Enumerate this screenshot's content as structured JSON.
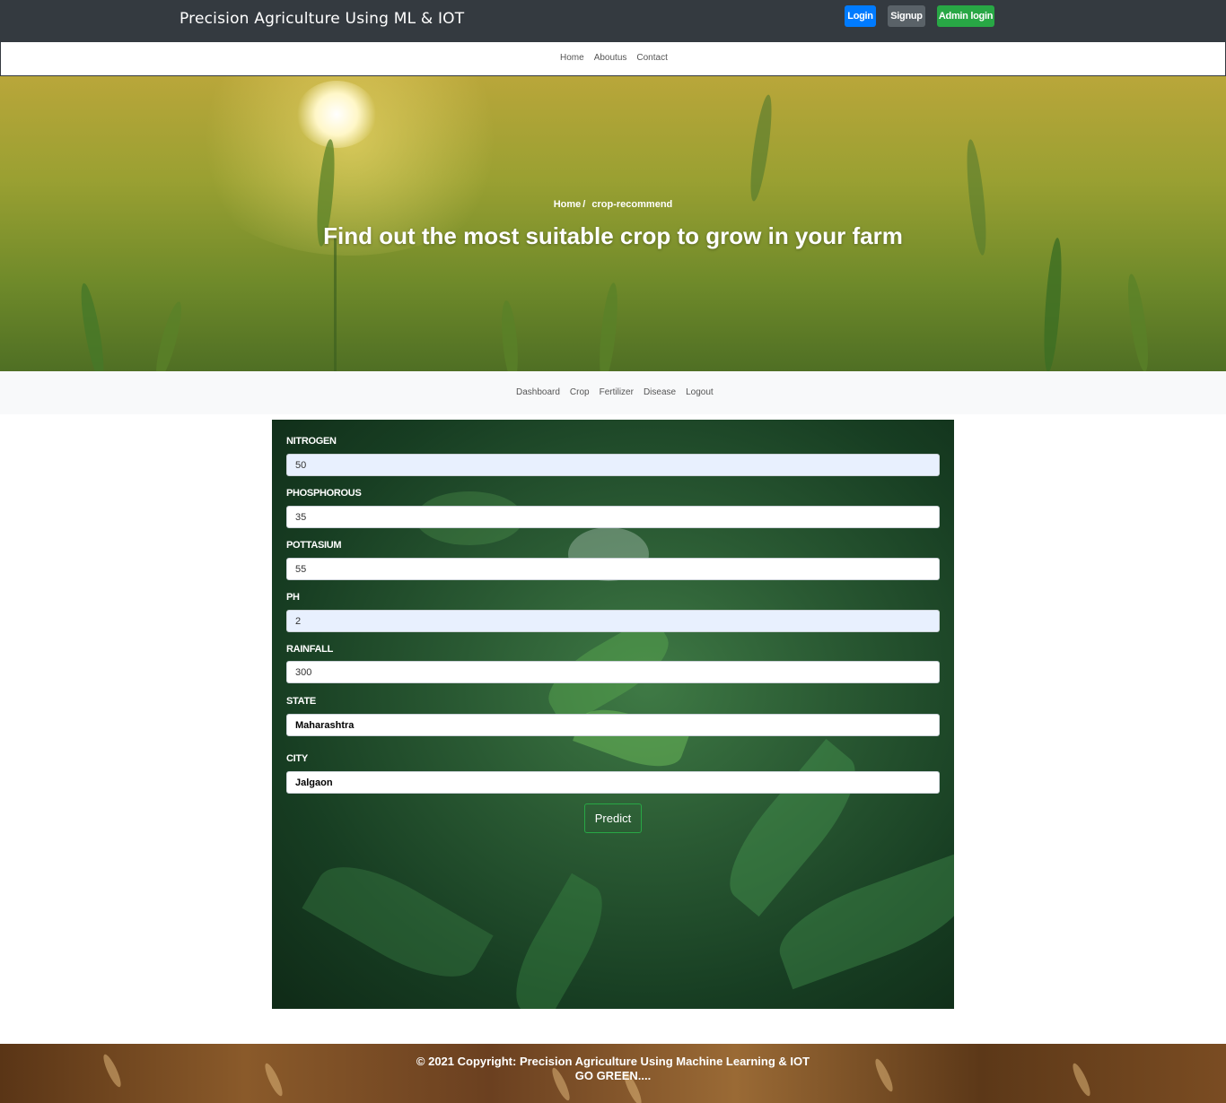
{
  "header": {
    "brand": "Precision Agriculture Using ML & IOT",
    "buttons": {
      "login": "Login",
      "signup": "Signup",
      "admin": "Admin login"
    }
  },
  "subnav": [
    "Home",
    "Aboutus",
    "Contact"
  ],
  "hero": {
    "breadcrumb_home": "Home",
    "breadcrumb_sep": "/",
    "breadcrumb_current": "crop-recommend",
    "title": "Find out the most suitable crop to grow in your farm"
  },
  "dashnav": [
    "Dashboard",
    "Crop",
    "Fertilizer",
    "Disease",
    "Logout"
  ],
  "form": {
    "fields": [
      {
        "label": "NITROGEN",
        "value": "50"
      },
      {
        "label": "PHOSPHOROUS",
        "value": "35"
      },
      {
        "label": "POTTASIUM",
        "value": "55"
      },
      {
        "label": "PH",
        "value": "2"
      },
      {
        "label": "RAINFALL",
        "value": "300"
      },
      {
        "label": "STATE",
        "value": "Maharashtra"
      },
      {
        "label": "CITY",
        "value": "Jalgaon"
      }
    ],
    "submit": "Predict"
  },
  "footer": {
    "copyright": "© 2021 Copyright: Precision Agriculture Using Machine Learning & IOT",
    "tagline": "GO GREEN...."
  },
  "colors": {
    "topbar": "#343a40",
    "login": "#007bff",
    "signup": "#5a6268",
    "admin": "#28a745"
  }
}
